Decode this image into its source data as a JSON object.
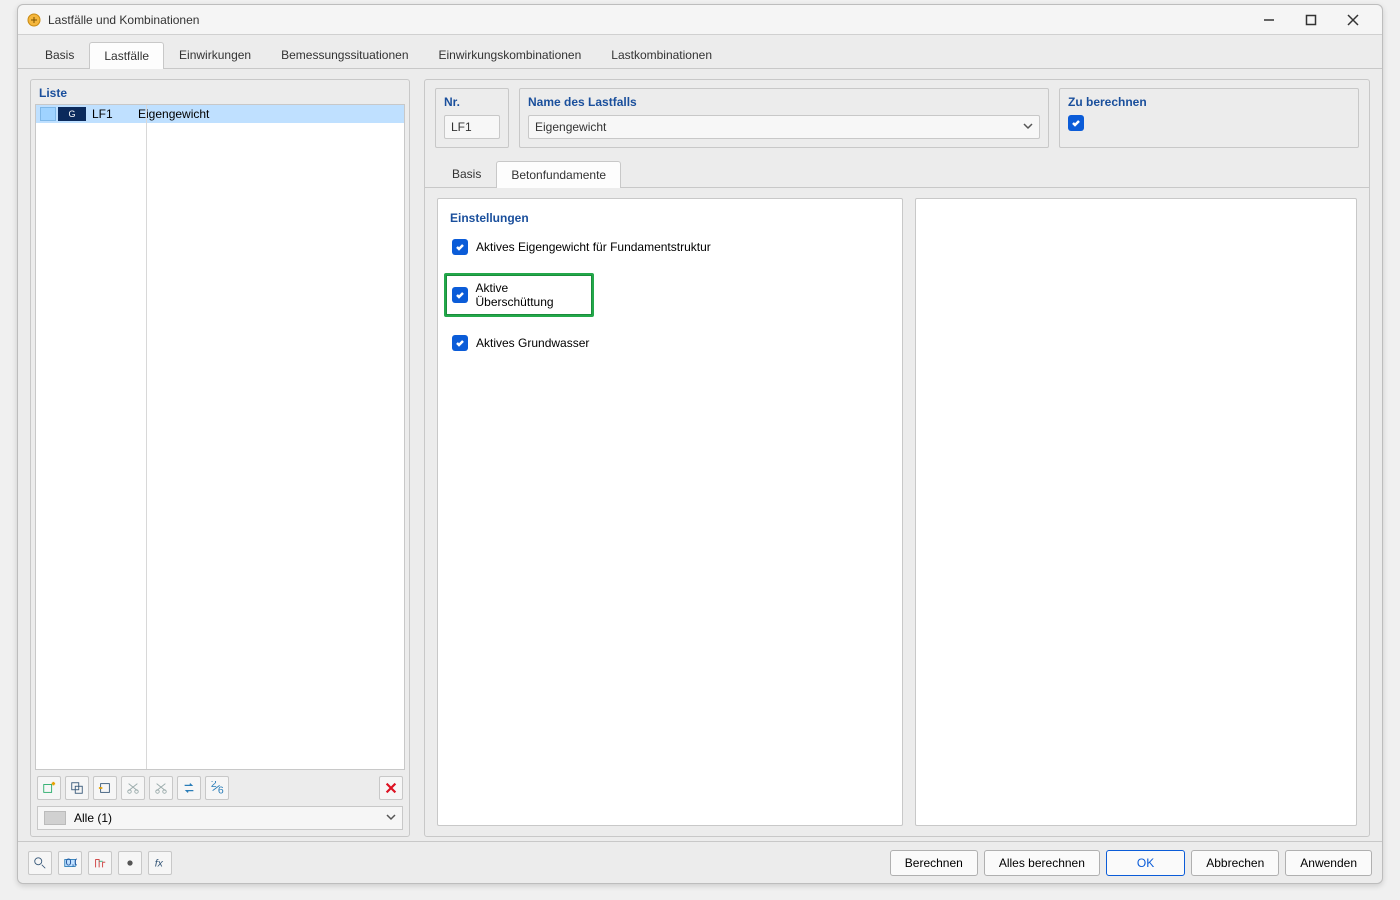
{
  "window": {
    "title": "Lastfälle und Kombinationen"
  },
  "tabs": {
    "items": [
      "Basis",
      "Lastfälle",
      "Einwirkungen",
      "Bemessungssituationen",
      "Einwirkungskombinationen",
      "Lastkombinationen"
    ],
    "active_index": 1
  },
  "left": {
    "heading": "Liste",
    "row": {
      "badge": "G",
      "code": "LF1",
      "name": "Eigengewicht"
    },
    "filter": {
      "label": "Alle (1)"
    }
  },
  "right": {
    "nr": {
      "label": "Nr.",
      "value": "LF1"
    },
    "name": {
      "label": "Name des Lastfalls",
      "value": "Eigengewicht"
    },
    "calc": {
      "label": "Zu berechnen",
      "checked": true
    },
    "subtabs": {
      "items": [
        "Basis",
        "Betonfundamente"
      ],
      "active_index": 1
    },
    "settings": {
      "title": "Einstellungen",
      "opt1": {
        "label": "Aktives Eigengewicht für Fundamentstruktur",
        "checked": true
      },
      "opt2": {
        "label": "Aktive Überschüttung",
        "checked": true
      },
      "opt3": {
        "label": "Aktives Grundwasser",
        "checked": true
      }
    }
  },
  "footer": {
    "berechnen": "Berechnen",
    "alles_berechnen": "Alles berechnen",
    "ok": "OK",
    "abbrechen": "Abbrechen",
    "anwenden": "Anwenden"
  },
  "icons": {
    "toolbar_left": [
      "new-item-icon",
      "duplicate-icon",
      "insert-icon",
      "cut-icon",
      "cut-alt-icon",
      "swap-icon",
      "renumber-icon",
      "delete-icon"
    ],
    "bottom": [
      "search-icon",
      "precision-icon",
      "structure-icon",
      "record-icon",
      "function-icon"
    ]
  }
}
